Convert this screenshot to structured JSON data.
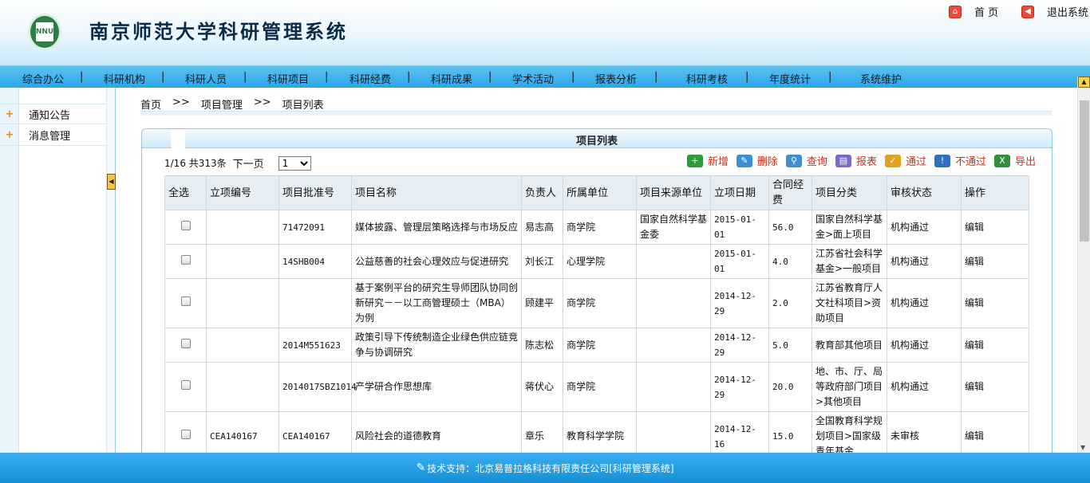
{
  "header": {
    "title": "南京师范大学科研管理系统",
    "logo_text": "NNU",
    "links": [
      {
        "label": "首 页",
        "icon": "home-icon"
      },
      {
        "label": "退出系统",
        "icon": "exit-icon"
      }
    ]
  },
  "nav": {
    "items": [
      "综合办公",
      "科研机构",
      "科研人员",
      "科研项目",
      "科研经费",
      "科研成果",
      "学术活动",
      "报表分析",
      "科研考核",
      "年度统计",
      "系统维护"
    ],
    "separator": "|"
  },
  "sidebar": {
    "items": [
      "通知公告",
      "消息管理"
    ]
  },
  "breadcrumb": {
    "items": [
      "首页",
      "项目管理",
      "项目列表"
    ],
    "separator": ">>"
  },
  "panel": {
    "title": "项目列表",
    "pager": {
      "info": "1/16 共313条",
      "next": "下一页",
      "page_value": "1"
    },
    "toolbar": [
      {
        "label": "新增",
        "icon": "add-icon",
        "color": "#2d9b3a"
      },
      {
        "label": "删除",
        "icon": "delete-icon",
        "color": "#3f8fd2"
      },
      {
        "label": "查询",
        "icon": "search-icon",
        "color": "#3f8fd2"
      },
      {
        "label": "报表",
        "icon": "report-icon",
        "color": "#7a6ad0"
      },
      {
        "label": "通过",
        "icon": "approve-icon",
        "color": "#e2a21e"
      },
      {
        "label": "不通过",
        "icon": "reject-icon",
        "color": "#2f6fc2"
      },
      {
        "label": "导出",
        "icon": "export-icon",
        "color": "#2e8f3c"
      }
    ]
  },
  "table": {
    "headers": [
      "全选",
      "立项编号",
      "项目批准号",
      "项目名称",
      "负责人",
      "所属单位",
      "项目来源单位",
      "立项日期",
      "合同经费",
      "项目分类",
      "审核状态",
      "操作"
    ],
    "rows": [
      [
        "",
        "",
        "71472091",
        "媒体披露、管理层策略选择与市场反应",
        "易志高",
        "商学院",
        "国家自然科学基金委",
        "2015-01-01",
        "56.0",
        "国家自然科学基金>面上项目",
        "机构通过",
        "编辑"
      ],
      [
        "",
        "",
        "14SHB004",
        "公益慈善的社会心理效应与促进研究",
        "刘长江",
        "心理学院",
        "",
        "2015-01-01",
        "4.0",
        "江苏省社会科学基金>一般项目",
        "机构通过",
        "编辑"
      ],
      [
        "",
        "",
        "",
        "基于案例平台的研究生导师团队协同创新研究－－以工商管理硕士（MBA）为例",
        "顾建平",
        "商学院",
        "",
        "2014-12-29",
        "2.0",
        "江苏省教育厅人文社科项目>资助项目",
        "机构通过",
        "编辑"
      ],
      [
        "",
        "",
        "2014M551623",
        "政策引导下传统制造企业绿色供应链竞争与协调研究",
        "陈志松",
        "商学院",
        "",
        "2014-12-29",
        "5.0",
        "教育部其他项目",
        "机构通过",
        "编辑"
      ],
      [
        "",
        "",
        "2014017SBZ1014",
        "产学研合作思想库",
        "蒋伏心",
        "商学院",
        "",
        "2014-12-29",
        "20.0",
        "地、市、厅、局等政府部门项目>其他项目",
        "机构通过",
        "编辑"
      ],
      [
        "",
        "CEA140167",
        "CEA140167",
        "风险社会的道德教育",
        "章乐",
        "教育科学学院",
        "",
        "2014-12-16",
        "15.0",
        "全国教育科学规划项目>国家级青年基金",
        "未审核",
        "编辑"
      ]
    ]
  },
  "footer": {
    "text": "技术支持：北京易普拉格科技有限责任公司[科研管理系统]"
  }
}
